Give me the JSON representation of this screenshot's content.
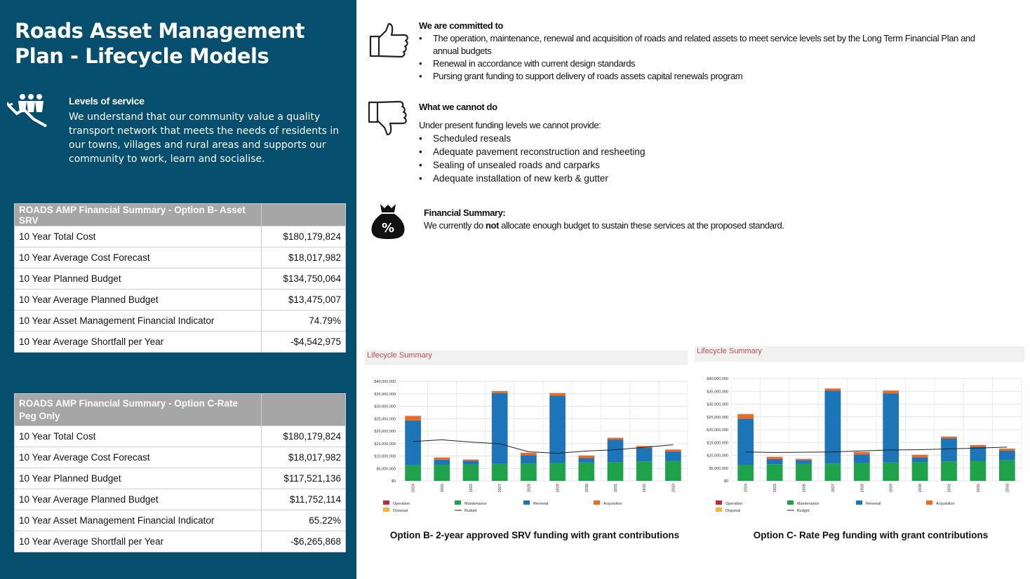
{
  "title": "Roads Asset Management Plan - Lifecycle Models",
  "icons": {
    "levels_of_service": "people-growth-icon",
    "committed": "thumbs-up-icon",
    "cannot": "thumbs-down-icon",
    "financial": "money-bag-percent-icon"
  },
  "colors": {
    "panel": "#054e6e",
    "operation": "#c0283c",
    "maintenance": "#1ea34a",
    "renewal": "#1b75b8",
    "acquisition": "#ee6a24",
    "disposal": "#f5b43b",
    "budget": "#222222"
  },
  "levels_of_service": {
    "heading": "Levels of service",
    "text": "We understand that our community value a quality transport network that meets the needs of residents in our towns, villages and rural areas and supports our community to work, learn and socialise."
  },
  "table_b": {
    "header": "ROADS AMP Financial Summary -  Option B- Asset SRV",
    "rows": [
      {
        "label": "10 Year Total Cost",
        "value": "$180,179,824"
      },
      {
        "label": "10 Year Average Cost Forecast",
        "value": "$18,017,982"
      },
      {
        "label": "10 Year Planned Budget",
        "value": "$134,750,064"
      },
      {
        "label": "10 Year Average Planned Budget",
        "value": "$13,475,007"
      },
      {
        "label": "10 Year Asset Management Financial Indicator",
        "value": "74.79%"
      },
      {
        "label": "10 Year  Average Shortfall per Year",
        "value": "-$4,542,975"
      }
    ]
  },
  "table_c": {
    "header": "ROADS AMP Financial Summary -  Option C-Rate Peg Only",
    "rows": [
      {
        "label": "10 Year Total Cost",
        "value": "$180,179,824"
      },
      {
        "label": "10 Year Average Cost Forecast",
        "value": "$18,017,982"
      },
      {
        "label": "10 Year Planned Budget",
        "value": "$117,521,136"
      },
      {
        "label": "10 Year Average Planned Budget",
        "value": "$11,752,114"
      },
      {
        "label": "10 Year Asset Management Financial Indicator",
        "value": "65.22%"
      },
      {
        "label": "10 Year  Average Shortfall per Year",
        "value": "-$6,265,868"
      }
    ]
  },
  "committed": {
    "heading": "We are committed to",
    "items": [
      "The operation, maintenance, renewal and acquisition of roads and related assets to meet service levels set by the Long Term Financial Plan and annual budgets",
      "Renewal in accordance with current design standards",
      "Pursing grant funding to support delivery of roads assets capital renewals program"
    ]
  },
  "cannot": {
    "heading": "What we cannot do",
    "intro": "Under present funding levels we cannot provide:",
    "items": [
      "Scheduled reseals",
      "Adequate pavement reconstruction and resheeting",
      "Sealing of unsealed roads and carparks",
      "Adequate installation of new kerb & gutter"
    ]
  },
  "financial_summary": {
    "heading": "Financial Summary:",
    "text_before": "We currently do ",
    "text_bold": "not",
    "text_after": " allocate enough budget to sustain these services at the proposed standard."
  },
  "captions": {
    "b": "Option B- 2-year approved SRV funding with grant contributions",
    "c": "Option C- Rate Peg funding with grant contributions"
  },
  "chart_data": [
    {
      "type": "bar",
      "stacked": true,
      "title": "Lifecycle Summary",
      "categories": [
        "2024",
        "2025",
        "2026",
        "2027",
        "2028",
        "2029",
        "2030",
        "2031",
        "2032",
        "2033"
      ],
      "yticks": [
        "$40,000,000",
        "$35,000,000",
        "$30,000,000",
        "$25,000,000",
        "$20,000,000",
        "$15,000,000",
        "$10,000,000",
        "$5,000,000",
        "$0"
      ],
      "ylim": [
        0,
        40000000
      ],
      "grid": true,
      "legend_position": "bottom",
      "series": [
        {
          "name": "Operation",
          "values": [
            0,
            0,
            0,
            0,
            0,
            0,
            0,
            0,
            0,
            0
          ]
        },
        {
          "name": "Maintenance",
          "values": [
            6300000,
            6500000,
            6600000,
            6800000,
            7000000,
            7200000,
            7400000,
            7600000,
            7800000,
            8000000
          ]
        },
        {
          "name": "Renewal",
          "values": [
            18000000,
            2000000,
            1500000,
            28500000,
            3300000,
            27000000,
            1800000,
            9000000,
            5500000,
            3800000
          ]
        },
        {
          "name": "Acquisition",
          "values": [
            1800000,
            900000,
            500000,
            800000,
            1000000,
            1100000,
            1000000,
            700000,
            700000,
            800000
          ]
        },
        {
          "name": "Disposal",
          "values": [
            0,
            0,
            0,
            0,
            0,
            0,
            0,
            0,
            0,
            0
          ]
        },
        {
          "name": "Budget",
          "type": "line",
          "values": [
            15800000,
            16500000,
            15600000,
            14900000,
            11700000,
            11100000,
            12000000,
            12500000,
            13500000,
            14500000
          ]
        }
      ]
    },
    {
      "type": "bar",
      "stacked": true,
      "title": "Lifecycle Summary",
      "categories": [
        "2024",
        "2025",
        "2026",
        "2027",
        "2028",
        "2029",
        "2030",
        "2031",
        "2032",
        "2033"
      ],
      "yticks": [
        "$40,000,000",
        "$35,000,000",
        "$30,000,000",
        "$25,000,000",
        "$20,000,000",
        "$15,000,000",
        "$10,000,000",
        "$5,000,000",
        "$0"
      ],
      "ylim": [
        0,
        40000000
      ],
      "grid": true,
      "legend_position": "bottom",
      "series": [
        {
          "name": "Operation",
          "values": [
            0,
            0,
            0,
            0,
            0,
            0,
            0,
            0,
            0,
            0
          ]
        },
        {
          "name": "Maintenance",
          "values": [
            6300000,
            6500000,
            6600000,
            6800000,
            7000000,
            7200000,
            7400000,
            7600000,
            7800000,
            8000000
          ]
        },
        {
          "name": "Renewal",
          "values": [
            18000000,
            2000000,
            1500000,
            28500000,
            3300000,
            27000000,
            1800000,
            9000000,
            5500000,
            3800000
          ]
        },
        {
          "name": "Acquisition",
          "values": [
            1800000,
            900000,
            500000,
            800000,
            1000000,
            1100000,
            1000000,
            700000,
            700000,
            800000
          ]
        },
        {
          "name": "Disposal",
          "values": [
            0,
            0,
            0,
            0,
            0,
            0,
            0,
            0,
            0,
            0
          ]
        },
        {
          "name": "Budget",
          "type": "line",
          "values": [
            11300000,
            11100000,
            11200000,
            11300000,
            11700000,
            12100000,
            12200000,
            12500000,
            12800000,
            13200000
          ]
        }
      ]
    }
  ]
}
